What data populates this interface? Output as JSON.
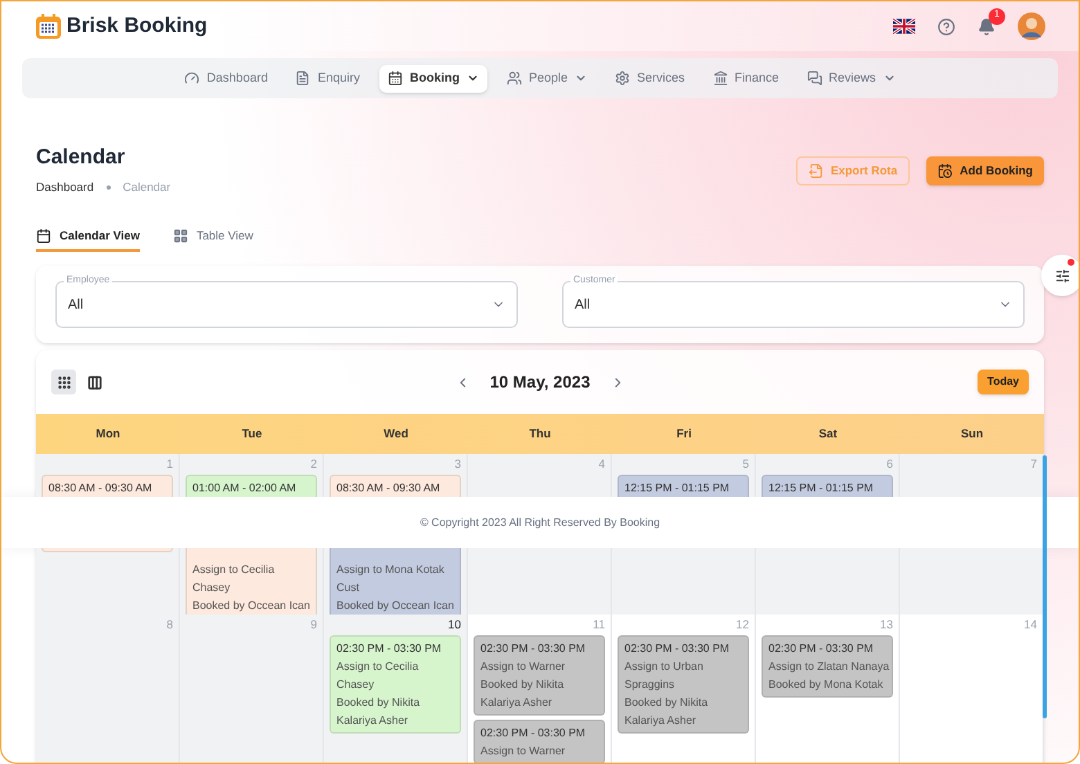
{
  "app": {
    "name": "Brisk Booking"
  },
  "header": {
    "notifications_badge": "1"
  },
  "nav": [
    {
      "label": "Dashboard",
      "selected": false,
      "has_menu": false
    },
    {
      "label": "Enquiry",
      "selected": false,
      "has_menu": false
    },
    {
      "label": "Booking",
      "selected": true,
      "has_menu": true
    },
    {
      "label": "People",
      "selected": false,
      "has_menu": true
    },
    {
      "label": "Services",
      "selected": false,
      "has_menu": false
    },
    {
      "label": "Finance",
      "selected": false,
      "has_menu": false
    },
    {
      "label": "Reviews",
      "selected": false,
      "has_menu": true
    }
  ],
  "page": {
    "title": "Calendar",
    "breadcrumb": [
      {
        "label": "Dashboard",
        "current": false
      },
      {
        "label": "Calendar",
        "current": true
      }
    ]
  },
  "actions": [
    {
      "label": "Export Rota",
      "kind": "outline"
    },
    {
      "label": "Add Booking",
      "kind": "primary"
    }
  ],
  "view_tabs": [
    {
      "label": "Calendar View",
      "selected": true
    },
    {
      "label": "Table View",
      "selected": false
    }
  ],
  "filters": [
    {
      "label": "Employee",
      "value": "All"
    },
    {
      "label": "Customer",
      "value": "All"
    }
  ],
  "calendar": {
    "date_label": "10 May, 2023",
    "today_button": "Today",
    "view_modes": [
      {
        "selected": true
      },
      {
        "selected": false
      }
    ],
    "weekdays": [
      "Mon",
      "Tue",
      "Wed",
      "Thu",
      "Fri",
      "Sat",
      "Sun"
    ],
    "weeks": [
      [
        {
          "date": "1",
          "past": true,
          "today": false,
          "events": [
            {
              "color": "#fde9dd",
              "lines": [
                "08:30 AM - 09:30 AM"
              ]
            }
          ],
          "events_below": [
            {
              "color": "#fde9dd"
            }
          ]
        },
        {
          "date": "2",
          "past": true,
          "today": false,
          "events": [
            {
              "color": "#d7f5cd",
              "lines": [
                "01:00 AM - 02:00 AM"
              ]
            }
          ],
          "events_below": [
            {
              "color": "#fde9dd",
              "lines": [
                "Assign to Cecilia",
                "Chasey",
                "Booked by Occean Ican"
              ]
            }
          ]
        },
        {
          "date": "3",
          "past": true,
          "today": false,
          "events": [
            {
              "color": "#fde9dd",
              "lines": [
                "08:30 AM - 09:30 AM"
              ]
            }
          ],
          "events_below": [
            {
              "color": "#c3cbe0",
              "lines": [
                "Assign to Mona Kotak",
                "Cust",
                "Booked by Occean Ican"
              ]
            }
          ]
        },
        {
          "date": "4",
          "past": true,
          "today": false
        },
        {
          "date": "5",
          "past": true,
          "today": false,
          "events": [
            {
              "color": "#c3cbe0",
              "lines": [
                "12:15 PM - 01:15 PM"
              ]
            }
          ]
        },
        {
          "date": "6",
          "past": true,
          "today": false,
          "events": [
            {
              "color": "#c3cbe0",
              "lines": [
                "12:15 PM - 01:15 PM"
              ]
            }
          ]
        },
        {
          "date": "7",
          "past": true,
          "today": false
        }
      ],
      [
        {
          "date": "8",
          "past": true,
          "today": false
        },
        {
          "date": "9",
          "past": true,
          "today": false
        },
        {
          "date": "10",
          "past": true,
          "today": true,
          "events": [
            {
              "color": "#d7f5cd",
              "lines": [
                "02:30 PM - 03:30 PM",
                "Assign to Cecilia",
                "Chasey",
                "Booked by Nikita",
                "Kalariya Asher"
              ]
            }
          ]
        },
        {
          "date": "11",
          "past": false,
          "today": false,
          "events": [
            {
              "color": "#c4c4c4",
              "lines": [
                "02:30 PM - 03:30 PM",
                "Assign to Warner",
                "Booked by Nikita",
                "Kalariya Asher"
              ]
            },
            {
              "color": "#c4c4c4",
              "lines": [
                "02:30 PM - 03:30 PM",
                "Assign to Warner"
              ]
            }
          ]
        },
        {
          "date": "12",
          "past": false,
          "today": false,
          "events": [
            {
              "color": "#c4c4c4",
              "lines": [
                "02:30 PM - 03:30 PM",
                "Assign to Urban",
                "Spraggins",
                "Booked by Nikita",
                "Kalariya Asher"
              ]
            }
          ]
        },
        {
          "date": "13",
          "past": false,
          "today": false,
          "events": [
            {
              "color": "#c4c4c4",
              "lines": [
                "02:30 PM - 03:30 PM",
                "Assign to Zlatan Nanaya",
                "Booked by Mona Kotak"
              ]
            }
          ]
        },
        {
          "date": "14",
          "past": false,
          "today": false
        }
      ]
    ]
  },
  "footer": {
    "copyright": "© Copyright 2023 All Right Reserved By Booking"
  }
}
